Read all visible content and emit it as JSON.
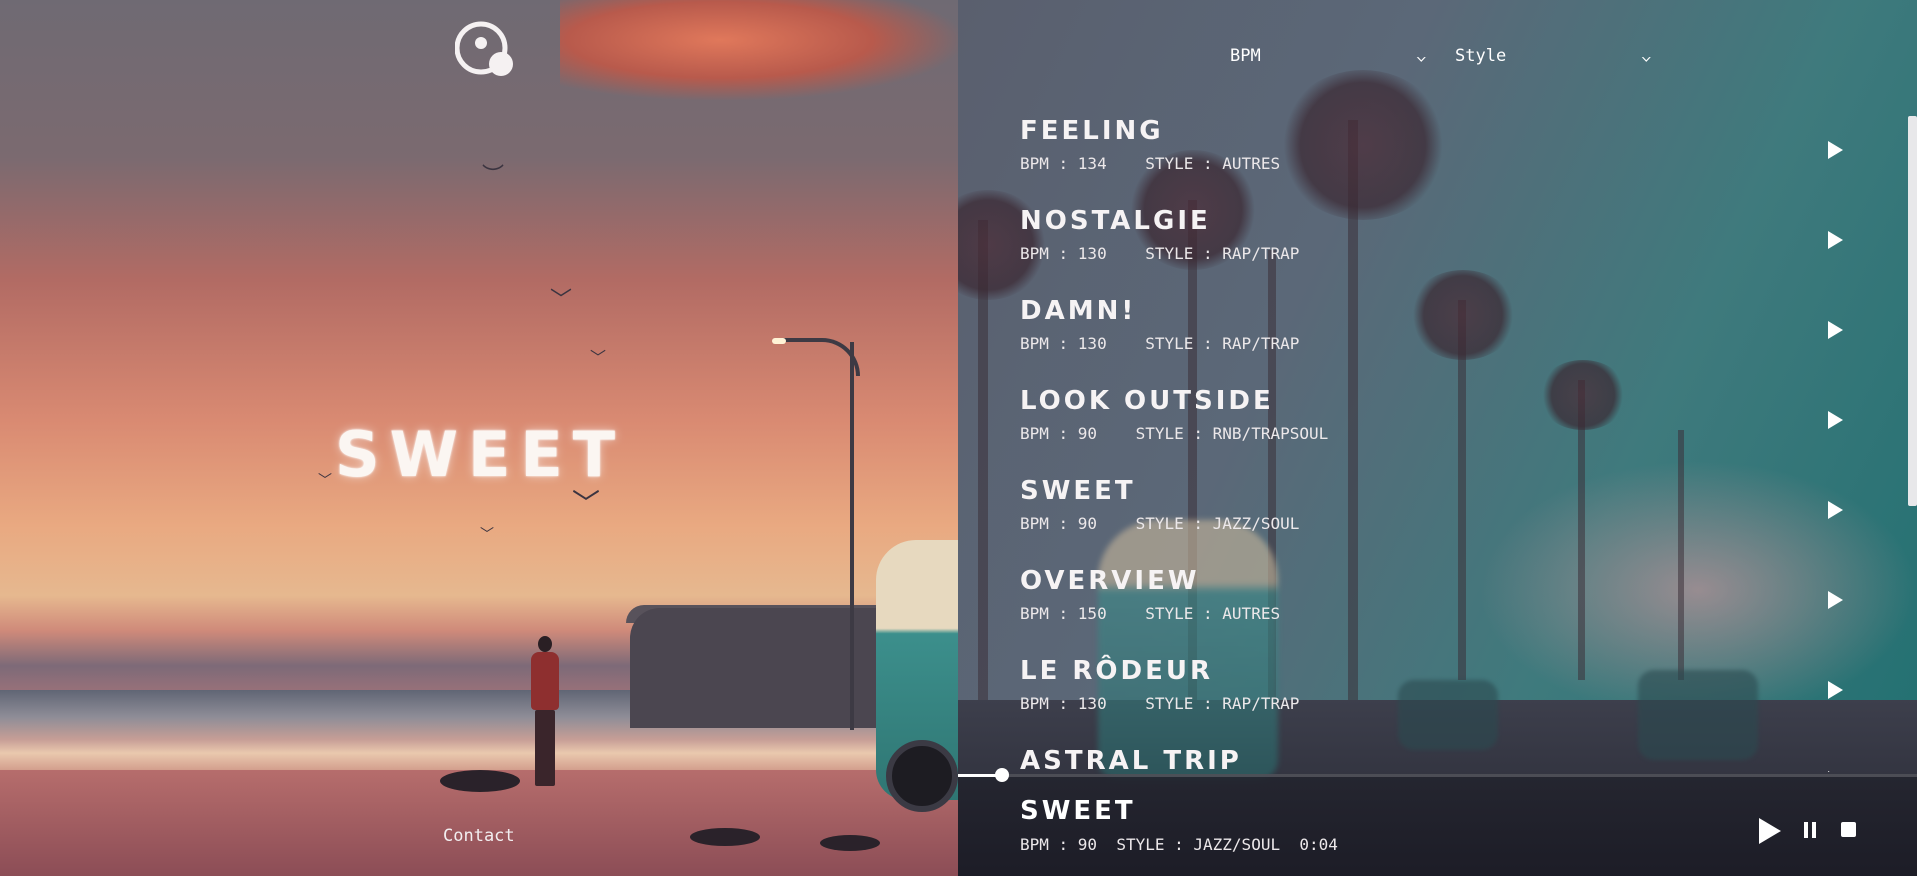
{
  "hero": {
    "title": "SWEET"
  },
  "footer": {
    "contact_label": "Contact"
  },
  "filters": {
    "bpm_label": "BPM",
    "style_label": "Style"
  },
  "tracks": [
    {
      "name": "FEELING",
      "meta": "BPM : 134    STYLE : AUTRES"
    },
    {
      "name": "NOSTALGIE",
      "meta": "BPM : 130    STYLE : RAP/TRAP"
    },
    {
      "name": "DAMN!",
      "meta": "BPM : 130    STYLE : RAP/TRAP"
    },
    {
      "name": "LOOK OUTSIDE",
      "meta": "BPM : 90    STYLE : RNB/TRAPSOUL"
    },
    {
      "name": "SWEET",
      "meta": "BPM : 90    STYLE : JAZZ/SOUL"
    },
    {
      "name": "OVERVIEW",
      "meta": "BPM : 150    STYLE : AUTRES"
    },
    {
      "name": "LE RÔDEUR",
      "meta": "BPM : 130    STYLE : RAP/TRAP"
    },
    {
      "name": "ASTRAL TRIP",
      "meta": ""
    }
  ],
  "player": {
    "now_playing": "SWEET",
    "meta": "BPM : 90  STYLE : JAZZ/SOUL  0:04",
    "progress": 0.02
  },
  "icons": {
    "logo": "orbit-logo-icon",
    "play": "play-icon",
    "pause": "pause-icon",
    "stop": "stop-icon",
    "chevron": "chevron-down-icon"
  }
}
